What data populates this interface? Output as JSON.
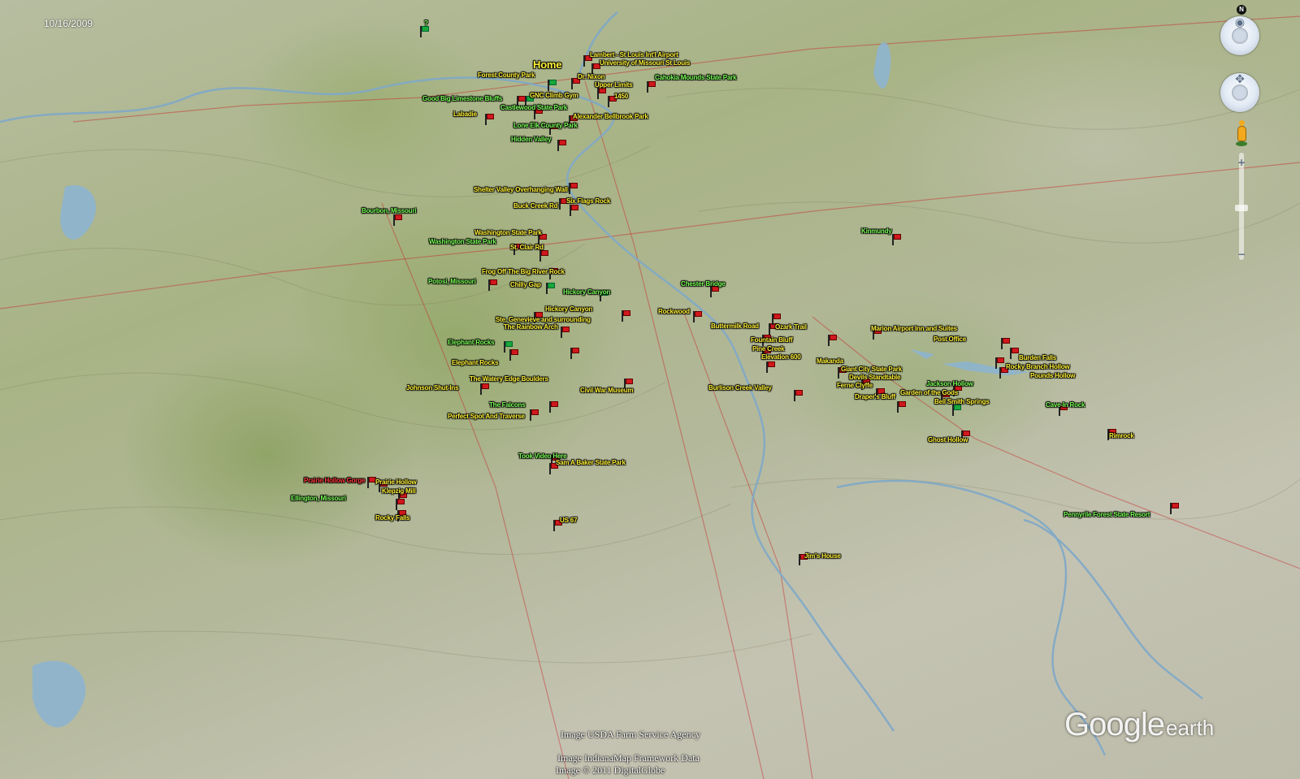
{
  "map": {
    "date": "10/16/2009",
    "home_label": "Home",
    "credits": [
      "Image USDA Farm Service Agency",
      "Image IndianaMap Framework Data",
      "Image © 2011 DigitalGlobe"
    ],
    "logo": {
      "brand": "Google",
      "product": "earth"
    },
    "compass_north": "N",
    "zoom_in": "+",
    "zoom_out": "−",
    "placemark_color_red": "#d0181c",
    "placemark_color_green": "#18a83a"
  },
  "labels": [
    {
      "t": "?",
      "c": "g"
    },
    {
      "t": "Lambert - St Louis Int'l Airport",
      "c": "y"
    },
    {
      "t": "University of Missouri St Louis",
      "c": "y"
    },
    {
      "t": "Forest County Park",
      "c": "y"
    },
    {
      "t": "Dr. Nixon",
      "c": "y"
    },
    {
      "t": "Upper Limits",
      "c": "y"
    },
    {
      "t": "Cahokia Mounds State Park",
      "c": "g"
    },
    {
      "t": "Good Big Limestone Bluffs",
      "c": "g"
    },
    {
      "t": "GNC Climb Gym",
      "c": "y"
    },
    {
      "t": "1450",
      "c": "y"
    },
    {
      "t": "Labadie",
      "c": "y"
    },
    {
      "t": "Castlewood State Park",
      "c": "g"
    },
    {
      "t": "Alexander Bellbrook Park",
      "c": "y"
    },
    {
      "t": "Lone Elk County Park",
      "c": "g"
    },
    {
      "t": "Hidden Valley",
      "c": "g"
    },
    {
      "t": "Shelter Valley Overhanging Wall",
      "c": "y"
    },
    {
      "t": "Buck Creek Rd",
      "c": "y"
    },
    {
      "t": "Six Flags Rock",
      "c": "y"
    },
    {
      "t": "Bourbon, Missouri",
      "c": "g"
    },
    {
      "t": "Washington State Park",
      "c": "y"
    },
    {
      "t": "Washington State Park",
      "c": "g"
    },
    {
      "t": "St. Clair Rd",
      "c": "y"
    },
    {
      "t": "Frog Off The Big River Rock",
      "c": "y"
    },
    {
      "t": "Potosi, Missouri",
      "c": "g"
    },
    {
      "t": "Chilly Gap",
      "c": "y"
    },
    {
      "t": "Hickory Canyon",
      "c": "g"
    },
    {
      "t": "Hickory Canyon",
      "c": "y"
    },
    {
      "t": "Ste. Genevieve and surrounding",
      "c": "y"
    },
    {
      "t": "The Rainbow Arch",
      "c": "y"
    },
    {
      "t": "Elephant Rocks",
      "c": "g"
    },
    {
      "t": "Elephant Rocks",
      "c": "y"
    },
    {
      "t": "The Watery Edge Boulders",
      "c": "y"
    },
    {
      "t": "Johnson Shut-Ins",
      "c": "y"
    },
    {
      "t": "Civil War Museum",
      "c": "y"
    },
    {
      "t": "The Falcons",
      "c": "g"
    },
    {
      "t": "Perfect Spot And Traverse",
      "c": "y"
    },
    {
      "t": "Took Video Here",
      "c": "g"
    },
    {
      "t": "Sam A Baker State Park",
      "c": "y"
    },
    {
      "t": "Prairie Hollow Gorge",
      "c": "r"
    },
    {
      "t": "Prairie Hollow",
      "c": "y"
    },
    {
      "t": "Ellington, Missouri",
      "c": "g"
    },
    {
      "t": "Klepzig Mill",
      "c": "y"
    },
    {
      "t": "Rocky Falls",
      "c": "y"
    },
    {
      "t": "US 67",
      "c": "y"
    },
    {
      "t": "Chester Bridge",
      "c": "g"
    },
    {
      "t": "Rockwood",
      "c": "y"
    },
    {
      "t": "Buttermilk Road",
      "c": "y"
    },
    {
      "t": "Ozark Trail",
      "c": "y"
    },
    {
      "t": "Fountain Bluff",
      "c": "y"
    },
    {
      "t": "Elevation 600",
      "c": "y"
    },
    {
      "t": "Giant City State Park",
      "c": "y"
    },
    {
      "t": "Makanda",
      "c": "y"
    },
    {
      "t": "Devils Standtable",
      "c": "y"
    },
    {
      "t": "Ferne Clyffe",
      "c": "y"
    },
    {
      "t": "Draper's Bluff",
      "c": "y"
    },
    {
      "t": "Jackson Hollow",
      "c": "g"
    },
    {
      "t": "Rocky Branch Hollow",
      "c": "y"
    },
    {
      "t": "Burden Falls",
      "c": "y"
    },
    {
      "t": "Cave-In Rock",
      "c": "g"
    },
    {
      "t": "Pounds Hollow",
      "c": "y"
    },
    {
      "t": "Garden of the Gods",
      "c": "y"
    },
    {
      "t": "Bell Smith Springs",
      "c": "y"
    },
    {
      "t": "Ghost Hollow",
      "c": "y"
    },
    {
      "t": "Marion Airport Inn and Suites",
      "c": "y"
    },
    {
      "t": "Post Office",
      "c": "y"
    },
    {
      "t": "Pine Creek",
      "c": "y"
    },
    {
      "t": "Pennyrile Forest State Resort",
      "c": "g"
    },
    {
      "t": "Jim's House",
      "c": "y"
    },
    {
      "t": "Burlison Creek Valley",
      "c": "y"
    },
    {
      "t": "Kinmundy",
      "c": "g"
    },
    {
      "t": "Rimrock",
      "c": "y"
    }
  ]
}
